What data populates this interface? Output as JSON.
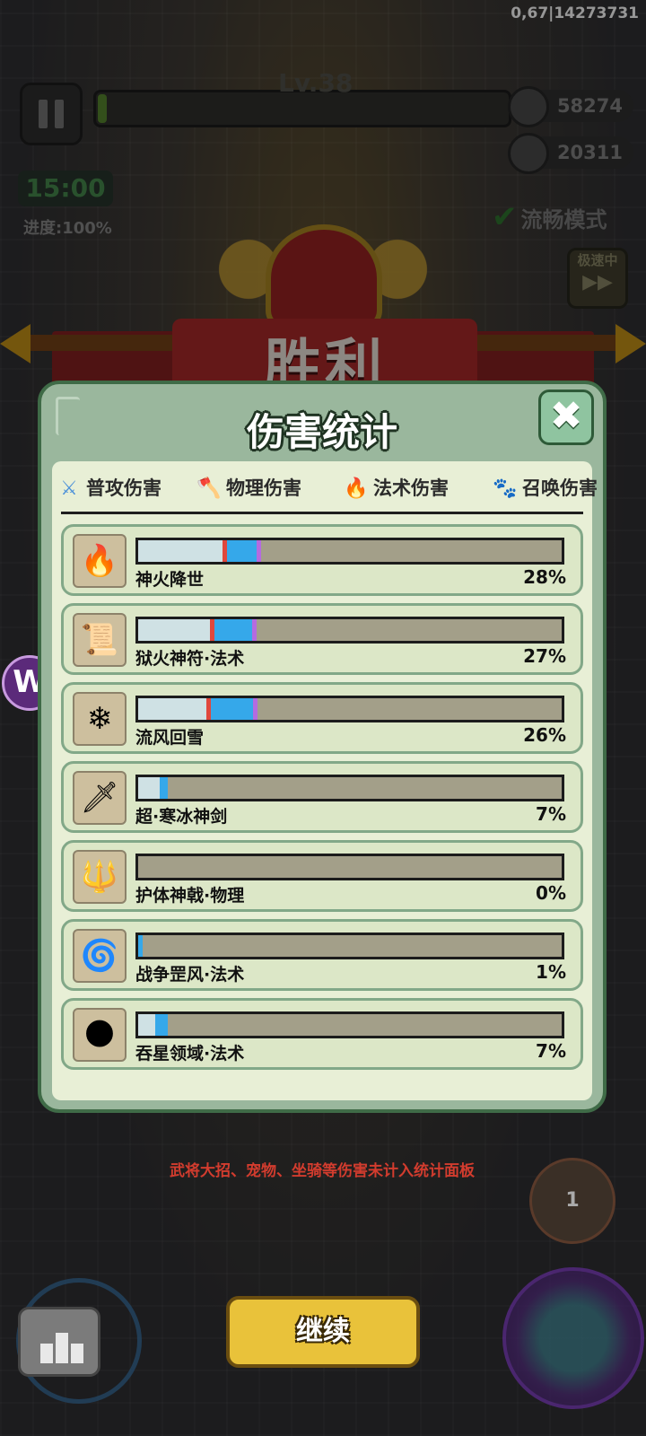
{
  "debug_text": "0,67|14273731",
  "hud": {
    "level_label": "Lv.38",
    "coins": "58274",
    "kills": "20311",
    "timer": "15:00",
    "progress": "进度:100%",
    "smooth_mode": "流畅模式",
    "speed_label": "极速中",
    "speed_arrows": "▶▶"
  },
  "victory": {
    "title": "胜利"
  },
  "panel": {
    "title": "伤害统计",
    "close_icon": "✖",
    "tabs": [
      {
        "label": "普攻伤害",
        "icon": "sword-icon",
        "color": "#4a90d9"
      },
      {
        "label": "物理伤害",
        "icon": "axe-icon",
        "color": "#d9302c"
      },
      {
        "label": "法术伤害",
        "icon": "flame-icon",
        "color": "#2f7fe0"
      },
      {
        "label": "召唤伤害",
        "icon": "paw-icon",
        "color": "#b02fc4"
      }
    ],
    "rows": [
      {
        "name": "神火降世",
        "pct_label": "28%",
        "glyph": "🔥",
        "segments": [
          0.2,
          0.01,
          0.07,
          0.01
        ]
      },
      {
        "name": "狱火神符·法术",
        "pct_label": "27%",
        "glyph": "📜",
        "segments": [
          0.17,
          0.01,
          0.09,
          0.01
        ]
      },
      {
        "name": "流风回雪",
        "pct_label": "26%",
        "glyph": "❄",
        "segments": [
          0.16,
          0.01,
          0.1,
          0.01
        ]
      },
      {
        "name": "超·寒冰神剑",
        "pct_label": "7%",
        "glyph": "🗡",
        "segments": [
          0.05,
          0.0,
          0.02,
          0.0
        ]
      },
      {
        "name": "护体神戟·物理",
        "pct_label": "0%",
        "glyph": "🔱",
        "segments": [
          0,
          0,
          0,
          0
        ]
      },
      {
        "name": "战争罡风·法术",
        "pct_label": "1%",
        "glyph": "🌀",
        "segments": [
          0.0,
          0.0,
          0.01,
          0.0
        ]
      },
      {
        "name": "吞星领域·法术",
        "pct_label": "7%",
        "glyph": "🌑",
        "segments": [
          0.04,
          0.0,
          0.03,
          0.0
        ]
      }
    ],
    "segment_colors": [
      "#cfe1e4",
      "#e0473c",
      "#35a8ea",
      "#b56be0"
    ],
    "note": "武将大招、宠物、坐骑等伤害未计入统计面板"
  },
  "continue_label": "继续",
  "gun_count": "1",
  "side_badge": "W"
}
